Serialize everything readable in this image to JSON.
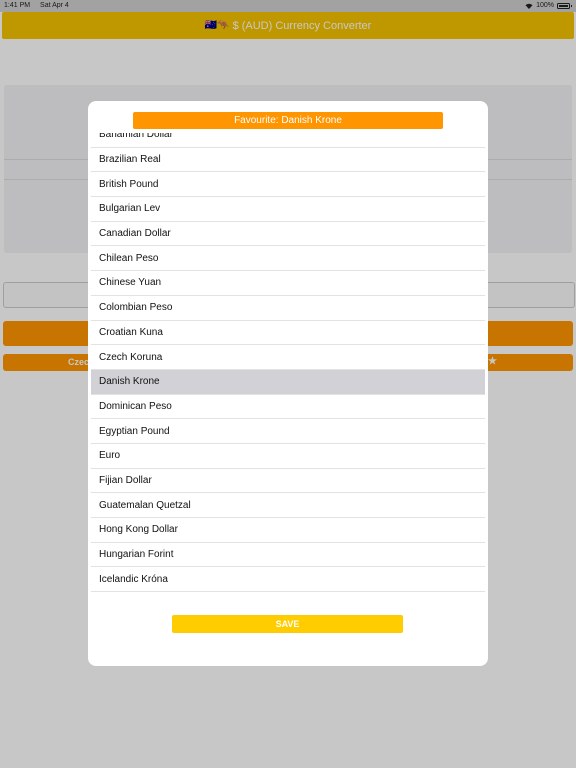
{
  "status_bar": {
    "time": "1:41 PM",
    "date": "Sat Apr 4",
    "battery": "100%"
  },
  "app": {
    "title": "$ (AUD) Currency Converter",
    "title_flags": "🇦🇺🦘",
    "favourite_bar_label": "Czec",
    "favourite_bar_star": "★"
  },
  "modal": {
    "favourite_banner": "Favourite: Danish Krone",
    "selected": "Danish Krone",
    "currencies": [
      "Bahamian Dollar",
      "Brazilian Real",
      "British Pound",
      "Bulgarian Lev",
      "Canadian Dollar",
      "Chilean Peso",
      "Chinese Yuan",
      "Colombian Peso",
      "Croatian Kuna",
      "Czech Koruna",
      "Danish Krone",
      "Dominican Peso",
      "Egyptian Pound",
      "Euro",
      "Fijian Dollar",
      "Guatemalan Quetzal",
      "Hong Kong Dollar",
      "Hungarian Forint",
      "Icelandic Króna"
    ],
    "save_label": "SAVE"
  }
}
